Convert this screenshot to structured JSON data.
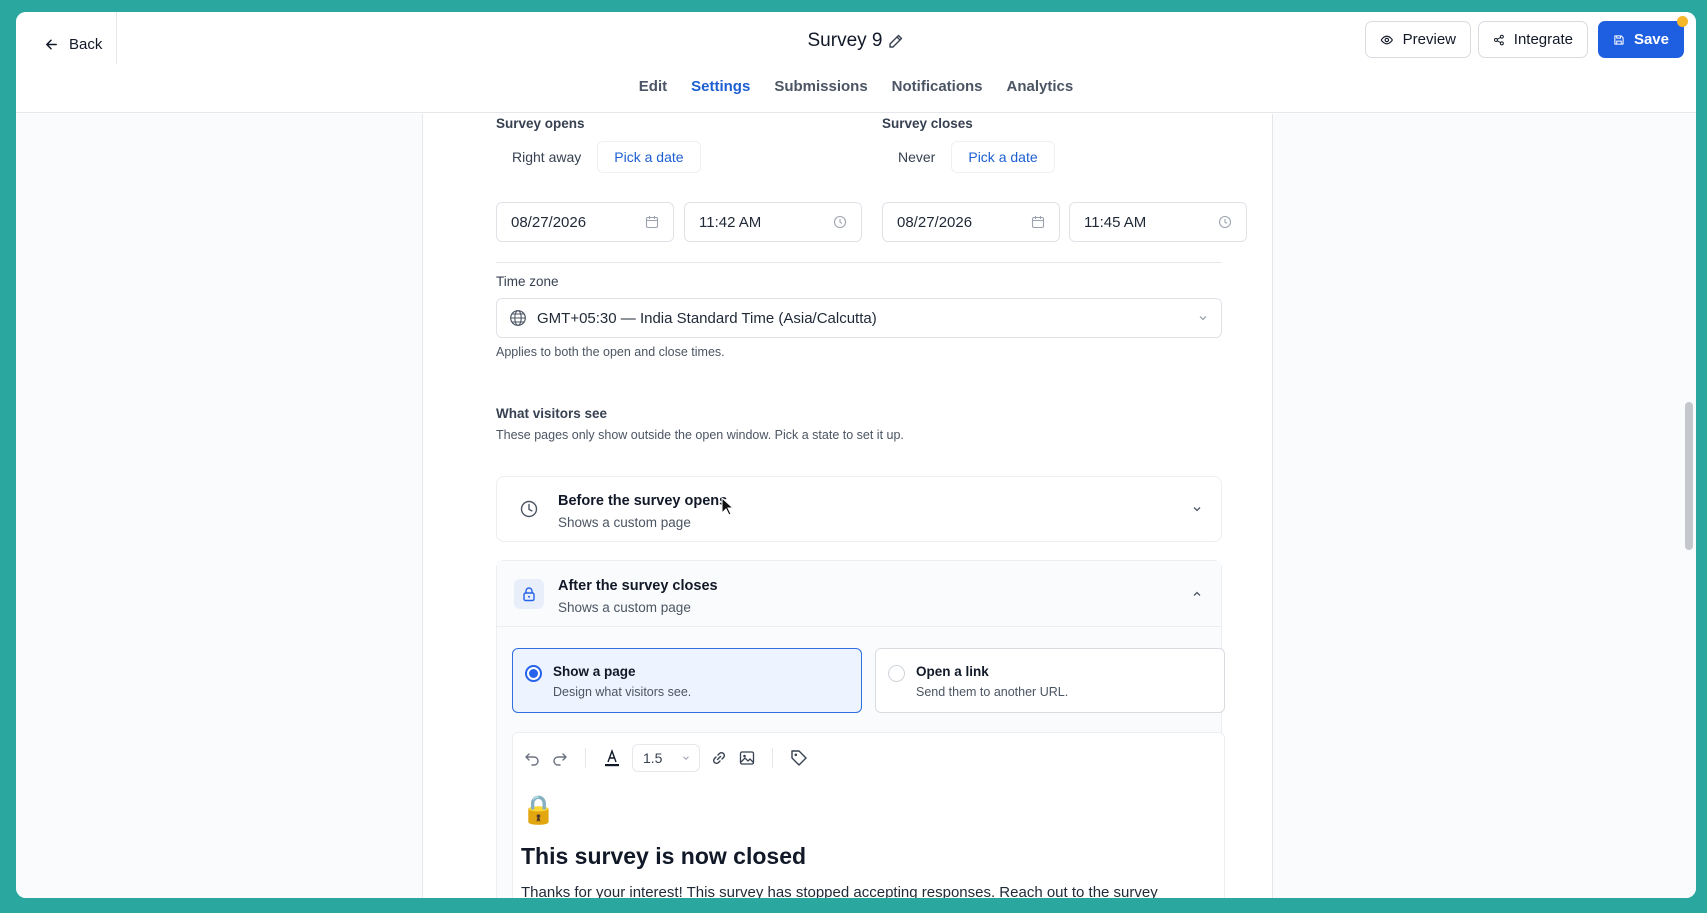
{
  "header": {
    "back_label": "Back",
    "title": "Survey 9",
    "tabs": [
      {
        "label": "Edit"
      },
      {
        "label": "Settings"
      },
      {
        "label": "Submissions"
      },
      {
        "label": "Notifications"
      },
      {
        "label": "Analytics"
      }
    ],
    "active_tab": "Settings",
    "preview_label": "Preview",
    "integrate_label": "Integrate",
    "save_label": "Save"
  },
  "schedule": {
    "opens": {
      "label": "Survey opens",
      "options": [
        "Right away",
        "Pick a date"
      ],
      "selected": "Pick a date",
      "date": "08/27/2026",
      "time": "11:42 AM"
    },
    "closes": {
      "label": "Survey closes",
      "options": [
        "Never",
        "Pick a date"
      ],
      "selected": "Pick a date",
      "date": "08/27/2026",
      "time": "11:45 AM"
    }
  },
  "timezone": {
    "label": "Time zone",
    "value": "GMT+05:30 — India Standard Time (Asia/Calcutta)",
    "help": "Applies to both the open and close times."
  },
  "visitors": {
    "label": "What visitors see",
    "help": "These pages only show outside the open window. Pick a state to set it up.",
    "before": {
      "title": "Before the survey opens",
      "subtitle": "Shows a custom page",
      "icon": "clock-icon",
      "expanded": false
    },
    "after": {
      "title": "After the survey closes",
      "subtitle": "Shows a custom page",
      "icon": "lock-icon",
      "expanded": true
    },
    "mode_options": [
      {
        "title": "Show a page",
        "subtitle": "Design what visitors see.",
        "selected": true
      },
      {
        "title": "Open a link",
        "subtitle": "Send them to another URL.",
        "selected": false
      }
    ]
  },
  "editor": {
    "line_height": "1.5",
    "emoji": "🔒",
    "heading": "This survey is now closed",
    "paragraph": "Thanks for your interest! This survey has stopped accepting responses. Reach out to the survey"
  },
  "colors": {
    "accent": "#1d5fe0",
    "notification_dot": "#f6b62a",
    "background": "#2aa79f"
  }
}
